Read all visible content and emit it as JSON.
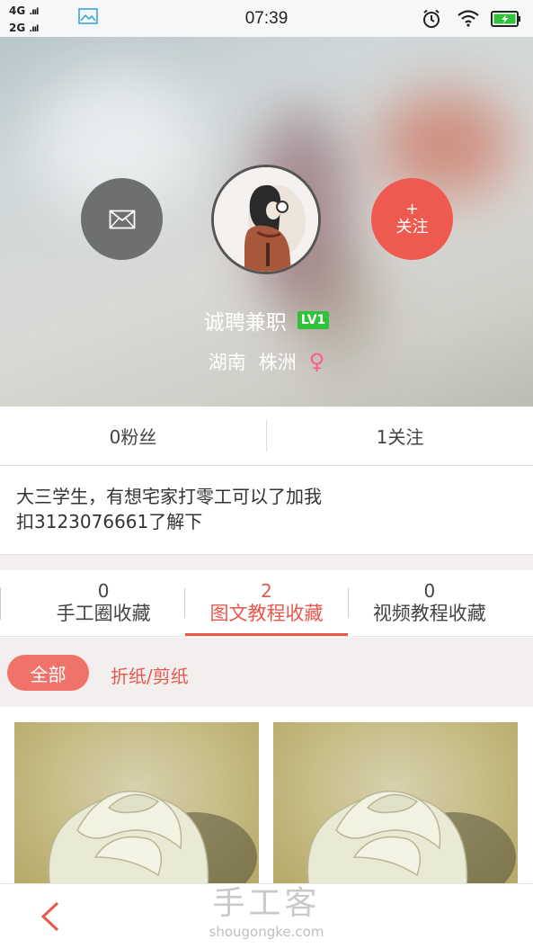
{
  "status_bar": {
    "network_1": "4G",
    "network_2": "2G",
    "time": "07:39"
  },
  "profile": {
    "username": "诚聘兼职",
    "level": "LV1",
    "province": "湖南",
    "city": "株洲",
    "gender_symbol": "♀",
    "follow_plus": "+",
    "follow_label": "关注"
  },
  "stats": {
    "fans": "0粉丝",
    "following": "1关注"
  },
  "bio": {
    "line1": "大三学生，有想宅家打零工可以了加我",
    "line2": "扣3123076661了解下"
  },
  "tabs": [
    {
      "count": "0",
      "label": "手工圈收藏",
      "active": false
    },
    {
      "count": "2",
      "label": "图文教程收藏",
      "active": true
    },
    {
      "count": "0",
      "label": "视频教程收藏",
      "active": false
    }
  ],
  "filter": {
    "all_label": "全部",
    "category_label": "折纸/剪纸"
  },
  "bottom": {
    "brand_cn": "手工客",
    "brand_url": "shougongke.com"
  },
  "colors": {
    "accent": "#e9574b",
    "follow_button": "#ee5a4f",
    "message_button": "#6e6f70",
    "level_badge": "#2fc23a",
    "gender": "#ff5a92"
  },
  "icons": {
    "message": "envelope-icon",
    "back": "chevron-left-icon",
    "alarm": "alarm-icon",
    "wifi": "wifi-icon",
    "battery": "battery-charging-icon",
    "screenshot": "image-icon"
  }
}
